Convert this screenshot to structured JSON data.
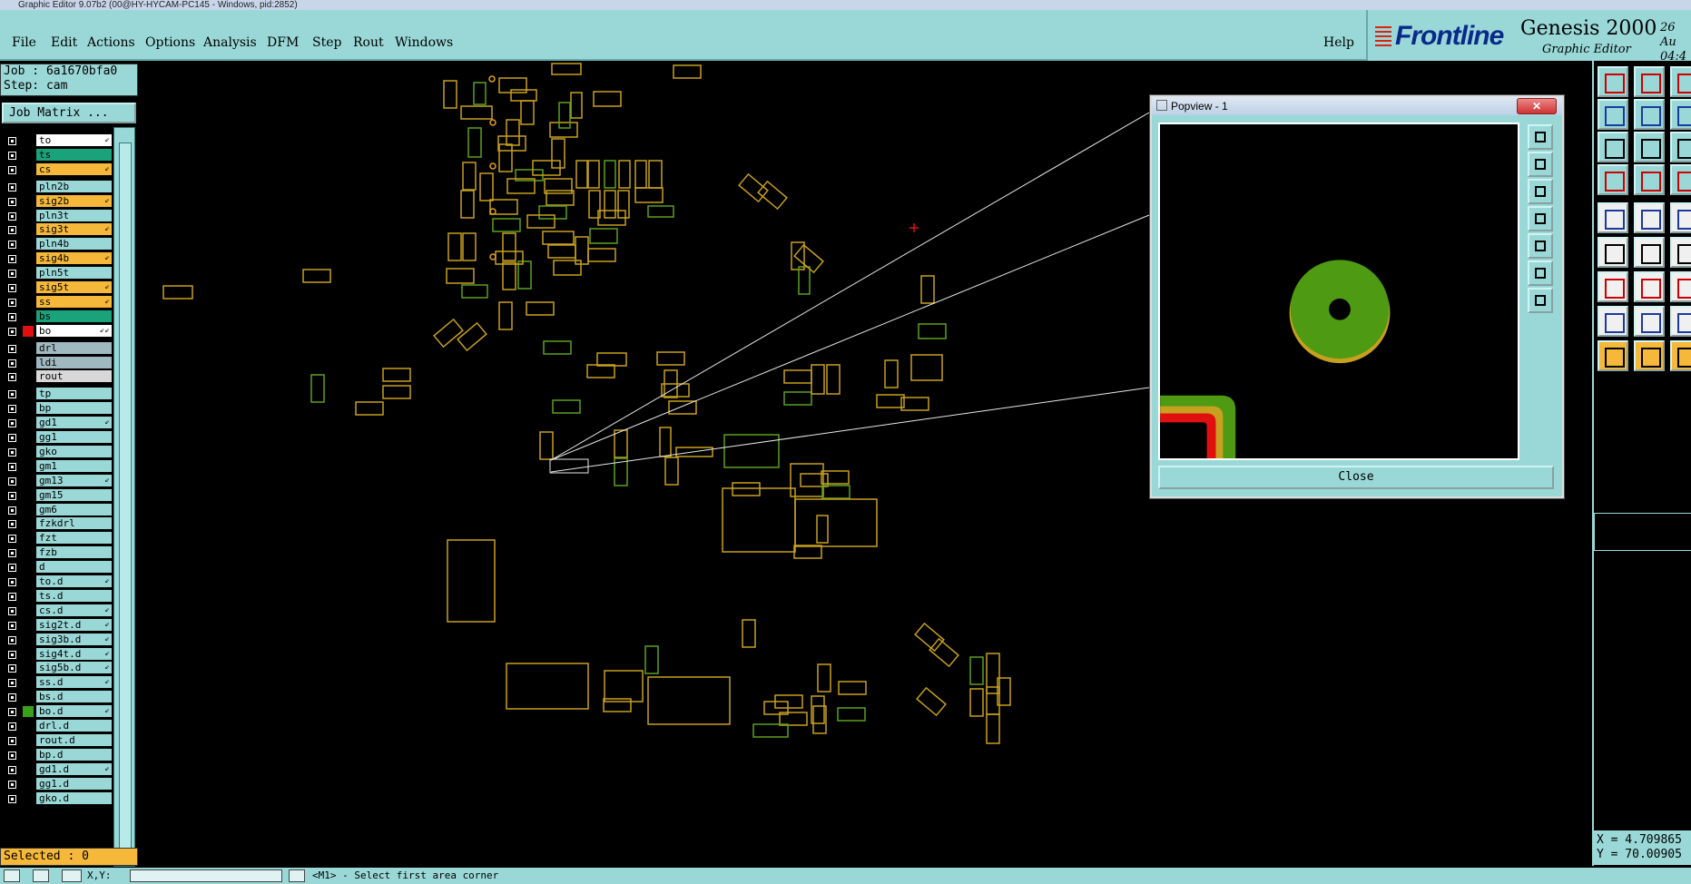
{
  "window": {
    "title": "Graphic Editor 9.07b2 (00@HY-HYCAM-PC145 - Windows, pid:2852)"
  },
  "menu": [
    "File",
    "Edit",
    "Actions",
    "Options",
    "Analysis",
    "DFM",
    "Step",
    "Rout",
    "Windows"
  ],
  "help_label": "Help",
  "brand": {
    "logo": "Frontline",
    "product": "Genesis 2000",
    "subtitle": "Graphic Editor",
    "date": "26 Au",
    "time": "04:4"
  },
  "job": {
    "job_line": "Job : 6a1670bfa0",
    "step_line": "Step: cam",
    "matrix_button": "Job Matrix ..."
  },
  "layers": [
    {
      "name": "to",
      "bg": "#ffffff",
      "color": "",
      "mark": "⇙"
    },
    {
      "name": "ts",
      "bg": "#1aa37a",
      "color": "",
      "mark": ""
    },
    {
      "name": "cs",
      "bg": "#f5b83a",
      "color": "",
      "mark": "⇙"
    },
    {
      "name": "pln2b",
      "bg": "#9ad8d8",
      "color": "",
      "mark": ""
    },
    {
      "name": "sig2b",
      "bg": "#f5b83a",
      "color": "",
      "mark": "⇙"
    },
    {
      "name": "pln3t",
      "bg": "#9ad8d8",
      "color": "",
      "mark": ""
    },
    {
      "name": "sig3t",
      "bg": "#f5b83a",
      "color": "",
      "mark": "⇙"
    },
    {
      "name": "pln4b",
      "bg": "#9ad8d8",
      "color": "",
      "mark": ""
    },
    {
      "name": "sig4b",
      "bg": "#f5b83a",
      "color": "",
      "mark": "⇙"
    },
    {
      "name": "pln5t",
      "bg": "#9ad8d8",
      "color": "",
      "mark": ""
    },
    {
      "name": "sig5t",
      "bg": "#f5b83a",
      "color": "",
      "mark": "⇙"
    },
    {
      "name": "ss",
      "bg": "#f5b83a",
      "color": "",
      "mark": "⇙"
    },
    {
      "name": "bs",
      "bg": "#1aa37a",
      "color": "",
      "mark": ""
    },
    {
      "name": "bo",
      "bg": "#ffffff",
      "color": "#e01010",
      "mark": "⇙⇙"
    },
    {
      "name": "drl",
      "bg": "#a0b8c0",
      "color": "",
      "mark": ""
    },
    {
      "name": "ldi",
      "bg": "#a0b8c0",
      "color": "",
      "mark": ""
    },
    {
      "name": "rout",
      "bg": "#d8d8d8",
      "color": "",
      "mark": ""
    },
    {
      "name": "tp",
      "bg": "#9ad8d8",
      "color": "",
      "mark": ""
    },
    {
      "name": "bp",
      "bg": "#9ad8d8",
      "color": "",
      "mark": ""
    },
    {
      "name": "gd1",
      "bg": "#9ad8d8",
      "color": "",
      "mark": "⇙"
    },
    {
      "name": "gg1",
      "bg": "#9ad8d8",
      "color": "",
      "mark": ""
    },
    {
      "name": "gko",
      "bg": "#9ad8d8",
      "color": "",
      "mark": ""
    },
    {
      "name": "gm1",
      "bg": "#9ad8d8",
      "color": "",
      "mark": ""
    },
    {
      "name": "gm13",
      "bg": "#9ad8d8",
      "color": "",
      "mark": "⇙"
    },
    {
      "name": "gm15",
      "bg": "#9ad8d8",
      "color": "",
      "mark": ""
    },
    {
      "name": "gm6",
      "bg": "#9ad8d8",
      "color": "",
      "mark": ""
    },
    {
      "name": "fzkdrl",
      "bg": "#9ad8d8",
      "color": "",
      "mark": ""
    },
    {
      "name": "fzt",
      "bg": "#9ad8d8",
      "color": "",
      "mark": ""
    },
    {
      "name": "fzb",
      "bg": "#9ad8d8",
      "color": "",
      "mark": ""
    },
    {
      "name": "d",
      "bg": "#9ad8d8",
      "color": "",
      "mark": ""
    },
    {
      "name": "to.d",
      "bg": "#9ad8d8",
      "color": "",
      "mark": "⇙"
    },
    {
      "name": "ts.d",
      "bg": "#9ad8d8",
      "color": "",
      "mark": ""
    },
    {
      "name": "cs.d",
      "bg": "#9ad8d8",
      "color": "",
      "mark": "⇙"
    },
    {
      "name": "sig2t.d",
      "bg": "#9ad8d8",
      "color": "",
      "mark": "⇙"
    },
    {
      "name": "sig3b.d",
      "bg": "#9ad8d8",
      "color": "",
      "mark": "⇙"
    },
    {
      "name": "sig4t.d",
      "bg": "#9ad8d8",
      "color": "",
      "mark": "⇙"
    },
    {
      "name": "sig5b.d",
      "bg": "#9ad8d8",
      "color": "",
      "mark": "⇙"
    },
    {
      "name": "ss.d",
      "bg": "#9ad8d8",
      "color": "",
      "mark": "⇙"
    },
    {
      "name": "bs.d",
      "bg": "#9ad8d8",
      "color": "",
      "mark": ""
    },
    {
      "name": "bo.d",
      "bg": "#9ad8d8",
      "color": "#3aa01a",
      "mark": "⇙"
    },
    {
      "name": "drl.d",
      "bg": "#9ad8d8",
      "color": "",
      "mark": ""
    },
    {
      "name": "rout.d",
      "bg": "#9ad8d8",
      "color": "",
      "mark": ""
    },
    {
      "name": "bp.d",
      "bg": "#9ad8d8",
      "color": "",
      "mark": ""
    },
    {
      "name": "gd1.d",
      "bg": "#9ad8d8",
      "color": "",
      "mark": "⇙"
    },
    {
      "name": "gg1.d",
      "bg": "#9ad8d8",
      "color": "",
      "mark": ""
    },
    {
      "name": "gko.d",
      "bg": "#9ad8d8",
      "color": "",
      "mark": ""
    }
  ],
  "selected": "Selected : 0",
  "popview": {
    "title": "Popview - 1",
    "close_label": "Close"
  },
  "status": {
    "coord_label": "X,Y:",
    "message": "<M1> - Select first area corner"
  },
  "coordinates": {
    "x": "X = 4.709865",
    "y": "Y = 70.00905"
  },
  "colors": {
    "panel": "#9ad8d8",
    "highlight": "#f5b83a",
    "canvas": "#000000",
    "pad_yellow": "#c8a020",
    "pad_green": "#5aa020"
  }
}
